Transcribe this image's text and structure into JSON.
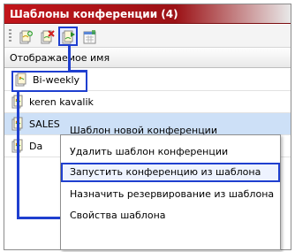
{
  "window": {
    "title": "Шаблоны конференции (4)"
  },
  "toolbar": {
    "buttons": [
      {
        "icon": "new-template-icon"
      },
      {
        "icon": "delete-template-icon"
      },
      {
        "icon": "start-conference-icon"
      },
      {
        "icon": "schedule-template-icon"
      }
    ]
  },
  "list": {
    "column_header": "Отображаемое имя",
    "rows": [
      {
        "label": "Bi-weekly"
      },
      {
        "label": "keren kavalik"
      },
      {
        "label": "SALES"
      },
      {
        "label": "Da"
      }
    ],
    "selected_index": 2
  },
  "context_menu": {
    "items": [
      {
        "label": "Шаблон новой конференции"
      },
      {
        "label": "Удалить шаблон конференции"
      },
      {
        "label": "Запустить конференцию из шаблона"
      },
      {
        "label": "Назначить резервирование из шаблона"
      },
      {
        "label": "Свойства шаблона"
      }
    ],
    "highlighted_index": 2
  },
  "colors": {
    "title_bar": "#c2151a",
    "highlight": "#1f3fcf",
    "selected_row": "#cde0f7"
  }
}
